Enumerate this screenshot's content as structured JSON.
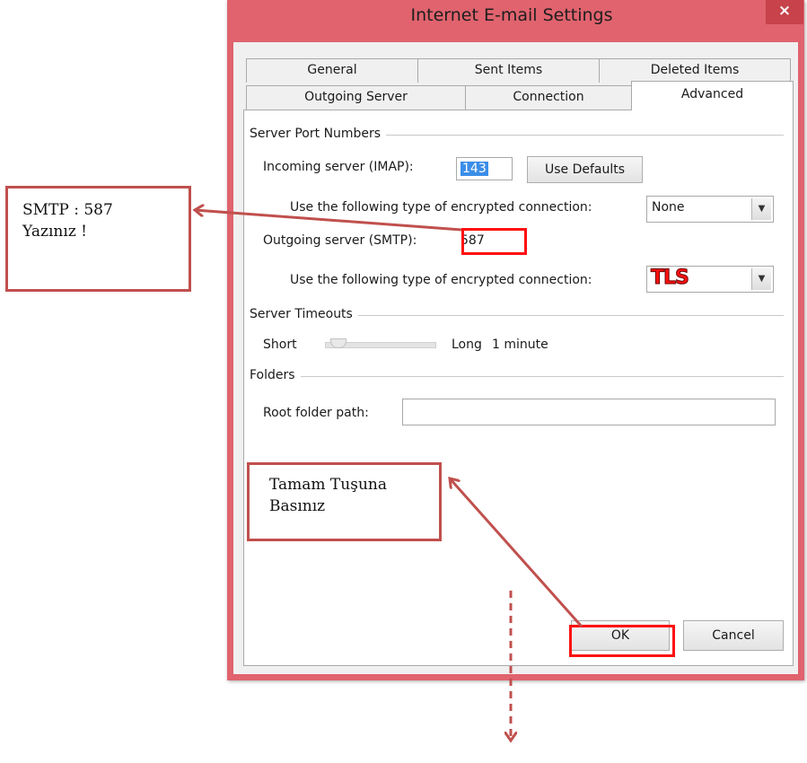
{
  "window": {
    "title": "Internet E-mail Settings",
    "close_symbol": "×"
  },
  "tabs": {
    "row1": [
      "General",
      "Sent Items",
      "Deleted Items"
    ],
    "row2": [
      "Outgoing Server",
      "Connection",
      "Advanced"
    ],
    "active": "Advanced"
  },
  "server_ports": {
    "group_label": "Server Port Numbers",
    "incoming_label": "Incoming server (IMAP):",
    "incoming_value": "143",
    "use_defaults": "Use Defaults",
    "encryption_label": "Use the following type of encrypted connection:",
    "incoming_encryption": "None",
    "outgoing_label": "Outgoing server (SMTP):",
    "outgoing_value": "587",
    "outgoing_encryption_overlay": "TLS"
  },
  "timeouts": {
    "group_label": "Server Timeouts",
    "short_label": "Short",
    "long_label": "Long",
    "value_label": "1 minute"
  },
  "folders": {
    "group_label": "Folders",
    "root_label": "Root folder path:",
    "root_value": ""
  },
  "footer": {
    "ok": "OK",
    "cancel": "Cancel"
  },
  "annotations": {
    "smtp_line1": "SMTP : 587",
    "smtp_line2": "Yazınız !",
    "ok_line1": "Tamam Tuşuna",
    "ok_line2": "Basınız",
    "accent_red": "#ff1010",
    "callout_border": "#c0504d"
  }
}
